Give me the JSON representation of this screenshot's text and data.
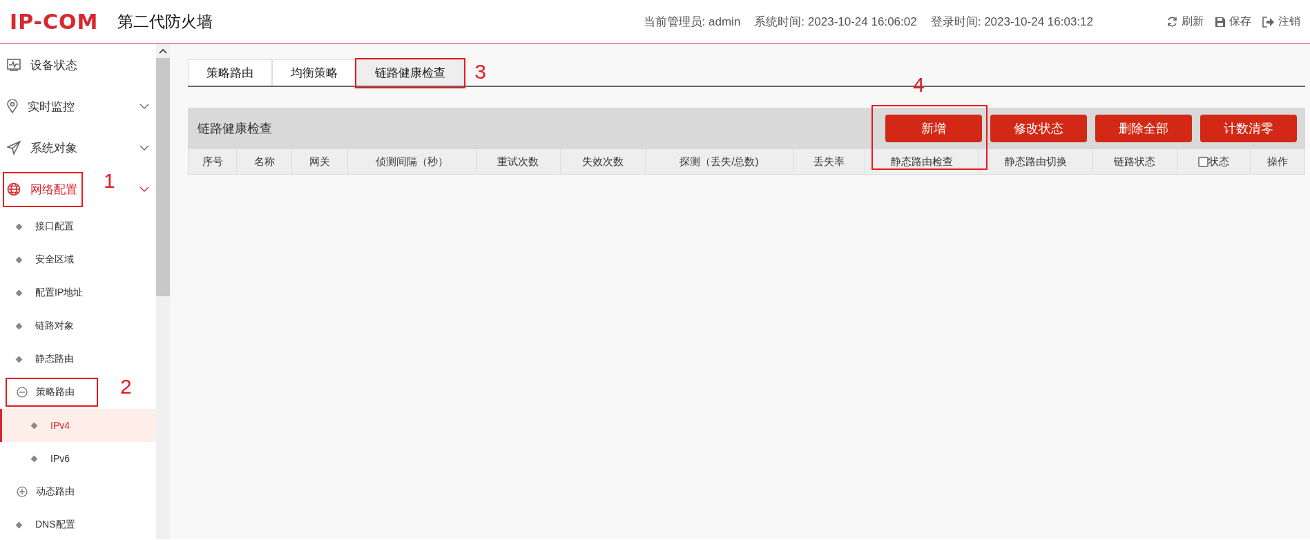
{
  "header": {
    "logo": "IP-COM",
    "title": "第二代防火墙",
    "info": [
      {
        "label": "当前管理员:",
        "value": "admin"
      },
      {
        "label": "系统时间:",
        "value": "2023-10-24 16:06:02"
      },
      {
        "label": "登录时间:",
        "value": "2023-10-24 16:03:12"
      }
    ],
    "actions": [
      {
        "label": "刷新"
      },
      {
        "label": "保存"
      },
      {
        "label": "注销"
      }
    ]
  },
  "sidebar": {
    "items": [
      {
        "kind": "page",
        "label": "设备状态",
        "selected": false
      },
      {
        "kind": "folder",
        "label": "实时监控",
        "selected": false
      },
      {
        "kind": "folder",
        "label": "系统对象",
        "selected": false
      },
      {
        "kind": "folder",
        "label": "网络配置",
        "selected": true,
        "annotation": "1",
        "children": [
          {
            "kind": "leaf",
            "label": "接口配置",
            "selected": false
          },
          {
            "kind": "leaf",
            "label": "安全区域",
            "selected": false
          },
          {
            "kind": "leaf",
            "label": "配置IP地址",
            "selected": false
          },
          {
            "kind": "leaf",
            "label": "链路对象",
            "selected": false
          },
          {
            "kind": "leaf",
            "label": "静态路由",
            "selected": false
          },
          {
            "kind": "group",
            "label": "策略路由",
            "expanded": true,
            "selected": false,
            "annotation": "2",
            "children": [
              {
                "kind": "leaf",
                "label": "IPv4",
                "selected": true
              },
              {
                "kind": "leaf",
                "label": "IPv6",
                "selected": false
              }
            ]
          },
          {
            "kind": "group",
            "label": "动态路由",
            "expanded": false,
            "selected": false
          },
          {
            "kind": "leaf",
            "label": "DNS配置",
            "selected": false
          }
        ]
      }
    ]
  },
  "tabs": [
    {
      "label": "策略路由",
      "selected": false
    },
    {
      "label": "均衡策略",
      "selected": false
    },
    {
      "label": "链路健康检查",
      "selected": true,
      "annotation": "3"
    }
  ],
  "panel": {
    "title": "链路健康检查",
    "buttons": [
      {
        "label": "新增",
        "annotation": "4"
      },
      {
        "label": "修改状态"
      },
      {
        "label": "删除全部"
      },
      {
        "label": "计数清零"
      }
    ],
    "columns": [
      {
        "kind": "text",
        "label": "序号"
      },
      {
        "kind": "text",
        "label": "名称"
      },
      {
        "kind": "text",
        "label": "网关"
      },
      {
        "kind": "text",
        "label": "侦测间隔（秒）"
      },
      {
        "kind": "text",
        "label": "重试次数"
      },
      {
        "kind": "text",
        "label": "失效次数"
      },
      {
        "kind": "text",
        "label": "探测（丢失/总数)"
      },
      {
        "kind": "text",
        "label": "丢失率"
      },
      {
        "kind": "text",
        "label": "静态路由检查"
      },
      {
        "kind": "text",
        "label": "静态路由切换"
      },
      {
        "kind": "text",
        "label": "链路状态"
      },
      {
        "kind": "checkbox",
        "label": "状态",
        "checked": false
      },
      {
        "kind": "text",
        "label": "操作"
      }
    ]
  }
}
